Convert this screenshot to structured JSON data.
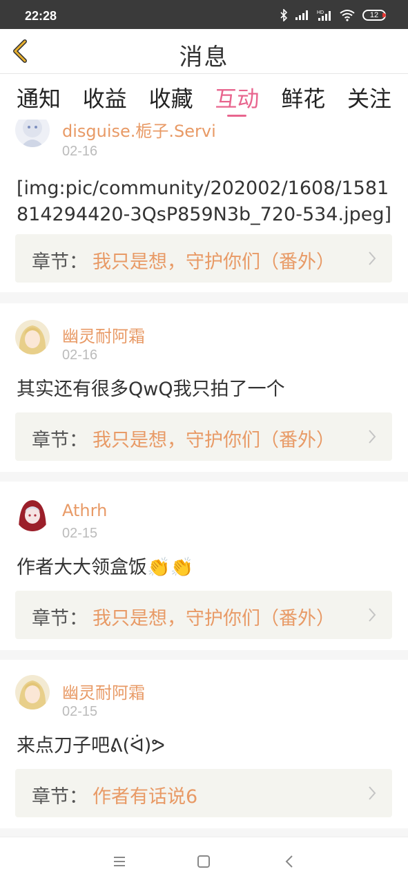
{
  "status_bar": {
    "time": "22:28",
    "battery": "12"
  },
  "header": {
    "title": "消息"
  },
  "tabs": [
    {
      "label": "通知",
      "active": false
    },
    {
      "label": "收益",
      "active": false
    },
    {
      "label": "收藏",
      "active": false
    },
    {
      "label": "互动",
      "active": true
    },
    {
      "label": "鲜花",
      "active": false
    },
    {
      "label": "关注",
      "active": false
    }
  ],
  "chapter_prefix": "章节：",
  "messages": [
    {
      "user": "disguise.栀子.Servi",
      "date": "02-16",
      "content": "[img:pic/community/202002/1608/1581814294420-3QsP859N3b_720-534.jpeg]",
      "chapter": "我只是想，守护你们（番外）"
    },
    {
      "user": "幽灵耐阿霜",
      "date": "02-16",
      "content": "其实还有很多QwQ我只拍了一个",
      "chapter": "我只是想，守护你们（番外）"
    },
    {
      "user": "Athrh",
      "date": "02-15",
      "content": "作者大大领盒饭👏👏",
      "chapter": "我只是想，守护你们（番外）"
    },
    {
      "user": "幽灵耐阿霜",
      "date": "02-15",
      "content": "来点刀子吧ᕕ(ᐛ)ᕗ",
      "chapter": "作者有话说6"
    }
  ],
  "colors": {
    "accent_pink": "#e8658e",
    "username_orange": "#e89a66",
    "back_arrow_yellow": "#e8b02e"
  }
}
